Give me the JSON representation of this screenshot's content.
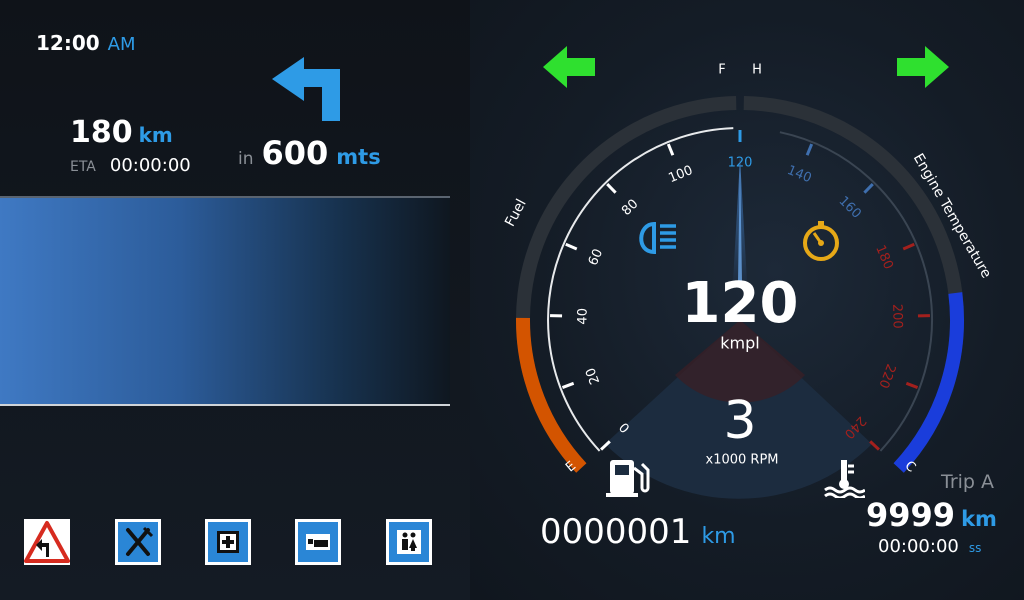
{
  "clock": {
    "time": "12:00",
    "ampm": "AM"
  },
  "navigation": {
    "remaining_distance": "180",
    "remaining_unit": "km",
    "eta_label": "ETA",
    "eta_time": "00:00:00",
    "turn_prefix": "in",
    "turn_distance": "600",
    "turn_unit": "mts",
    "turn_direction": "turn-left-arrow-icon"
  },
  "poi_icons": [
    {
      "name": "sharp-turn-left-warning-icon"
    },
    {
      "name": "restaurant-icon"
    },
    {
      "name": "hospital-icon"
    },
    {
      "name": "hotel-bed-icon"
    },
    {
      "name": "restroom-icon"
    }
  ],
  "indicators": {
    "left_signal": "left-turn-signal-icon",
    "right_signal": "right-turn-signal-icon",
    "signal_color": "#2fe02f"
  },
  "speedometer": {
    "tick_labels": [
      "0",
      "20",
      "40",
      "60",
      "80",
      "100",
      "120",
      "140",
      "160",
      "180",
      "200",
      "220",
      "240"
    ],
    "value": "120",
    "value_unit": "kmpl",
    "rpm_value": "3",
    "rpm_unit": "x1000 RPM"
  },
  "fuel_gauge": {
    "label": "Fuel",
    "full_marker": "F",
    "empty_marker": "E",
    "level": 0.33,
    "color": "#d35400"
  },
  "temp_gauge": {
    "label": "Engine Temperature",
    "hot_marker": "H",
    "cold_marker": "C",
    "level": 0.38,
    "color": "#1a3ddb"
  },
  "warning_icons": {
    "headlight": "high-beam-icon",
    "cruise": "cruise-control-icon"
  },
  "odometer": {
    "value": "0000001",
    "unit": "km"
  },
  "trip": {
    "label": "Trip A",
    "distance": "9999",
    "distance_unit": "km",
    "time": "00:00:00",
    "time_unit": "ss"
  },
  "colors": {
    "accent": "#2e9be6",
    "fuel": "#d35400",
    "temp": "#1a3ddb",
    "redzone": "#a3201d"
  }
}
